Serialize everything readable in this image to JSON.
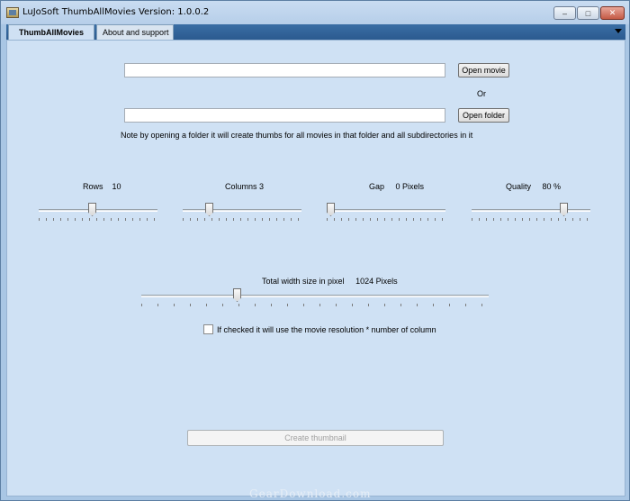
{
  "window": {
    "title": "LuJoSoft ThumbAllMovies Version: 1.0.0.2"
  },
  "tabs": [
    {
      "label": "ThumbAllMovies"
    },
    {
      "label": "About and support"
    }
  ],
  "movie": {
    "value": "",
    "button_label": "Open movie"
  },
  "or_label": "Or",
  "folder": {
    "value": "",
    "button_label": "Open folder",
    "note": "Note by opening a folder it will create thumbs for all movies in that folder and all subdirectories in it"
  },
  "sliders": {
    "rows": {
      "label": "Rows",
      "value": "10",
      "level": 0.45
    },
    "columns": {
      "label": "Columns 3",
      "level": 0.2
    },
    "gap": {
      "label": "Gap",
      "value": "0 Pixels",
      "level": 0.0
    },
    "quality": {
      "label": "Quality",
      "value": "80 %",
      "level": 0.8
    }
  },
  "width": {
    "label": "Total width size in pixel",
    "value": "1024 Pixels",
    "level": 0.27
  },
  "resolution_checkbox": {
    "checked": false,
    "label": "If checked it will use the movie resolution * number of column"
  },
  "create_button_label": "Create thumbnail",
  "watermark": "GearDownload.com"
}
